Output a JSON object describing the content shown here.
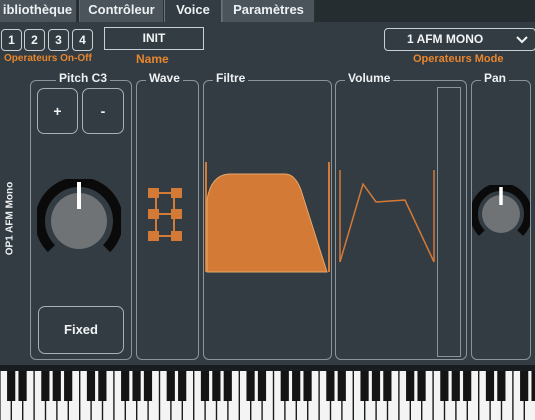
{
  "tabs": [
    {
      "label": "ibliothèque",
      "active": false
    },
    {
      "label": "Contrôleur",
      "active": false
    },
    {
      "label": "Voice",
      "active": true
    },
    {
      "label": "Paramètres",
      "active": false
    }
  ],
  "operators": {
    "buttons": [
      "1",
      "2",
      "3",
      "4"
    ],
    "label": "Operateurs On-Off"
  },
  "name": {
    "value": "INIT",
    "label": "Name"
  },
  "mode": {
    "value": "1 AFM MONO",
    "label": "Operateurs Mode"
  },
  "operator_label": "OP1 AFM Mono",
  "panels": {
    "pitch": {
      "title": "Pitch C3",
      "plus": "+",
      "minus": "-",
      "fixed": "Fixed"
    },
    "wave": {
      "title": "Wave"
    },
    "filtre": {
      "title": "Filtre"
    },
    "volume": {
      "title": "Volume"
    },
    "pan": {
      "title": "Pan"
    }
  },
  "colors": {
    "accent": "#e8862e",
    "bg": "#323c42",
    "fill": "#d47a37"
  }
}
